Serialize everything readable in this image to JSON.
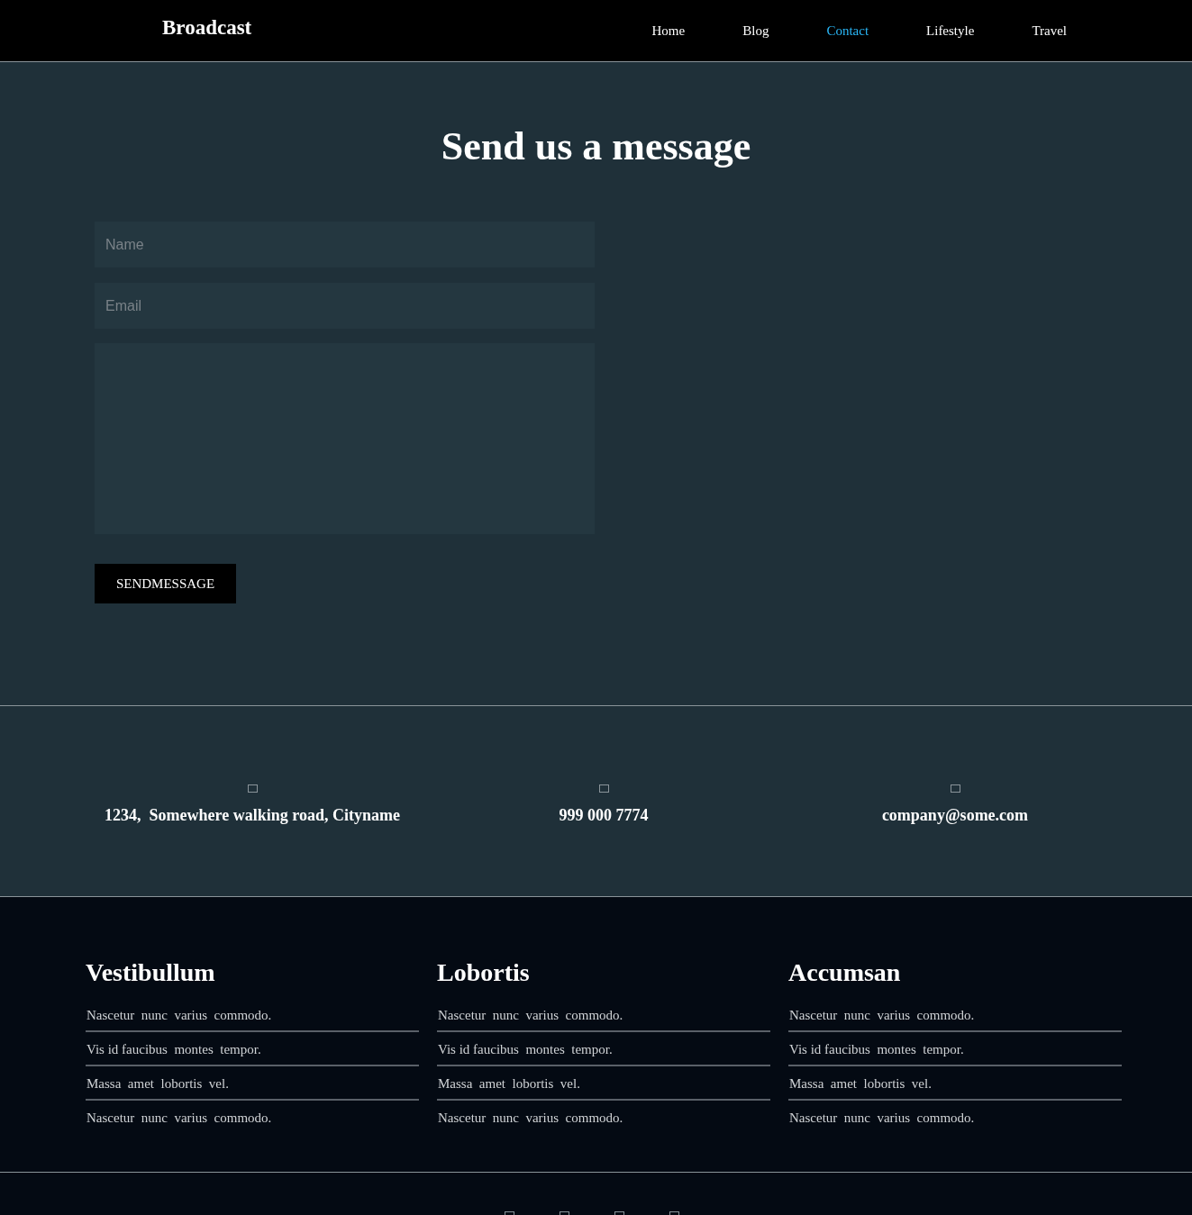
{
  "header": {
    "brand": "Broadcast",
    "nav": [
      {
        "label": "Home",
        "selected": false
      },
      {
        "label": "Blog",
        "selected": false
      },
      {
        "label": "Contact",
        "selected": true
      },
      {
        "label": "Lifestyle",
        "selected": false
      },
      {
        "label": "Travel",
        "selected": false
      }
    ]
  },
  "form": {
    "title": "Send us a message",
    "name": {
      "placeholder": "Name"
    },
    "email": {
      "placeholder": "Email"
    },
    "button": "SENDMESSAGE"
  },
  "contact_info": [
    {
      "text": "1234,  Somewhere walking road, Cityname"
    },
    {
      "text": "999 000 7774"
    },
    {
      "text": "company@some.com"
    }
  ],
  "footer": {
    "columns": [
      {
        "title": "Vestibullum",
        "links": [
          "Nascetur  nunc  varius  commodo.",
          "Vis id faucibus  montes  tempor.",
          "Massa  amet  lobortis  vel.",
          "Nascetur  nunc  varius  commodo."
        ]
      },
      {
        "title": "Lobortis",
        "links": [
          "Nascetur  nunc  varius  commodo.",
          "Vis id faucibus  montes  tempor.",
          "Massa  amet  lobortis  vel.",
          "Nascetur  nunc  varius  commodo."
        ]
      },
      {
        "title": "Accumsan",
        "links": [
          "Nascetur  nunc  varius  commodo.",
          "Vis id faucibus  montes  tempor.",
          "Massa  amet  lobortis  vel.",
          "Nascetur  nunc  varius  commodo."
        ]
      }
    ]
  }
}
